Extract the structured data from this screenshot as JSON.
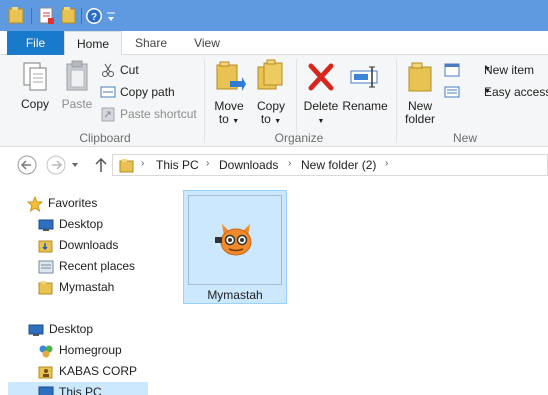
{
  "ribbon_tabs": {
    "file": "File",
    "home": "Home",
    "share": "Share",
    "view": "View"
  },
  "clipboard": {
    "copy": "Copy",
    "paste": "Paste",
    "cut": "Cut",
    "copy_path": "Copy path",
    "paste_shortcut": "Paste shortcut",
    "label": "Clipboard"
  },
  "organize": {
    "move_to": "Move",
    "move_to_2": "to",
    "copy_to": "Copy",
    "copy_to_2": "to",
    "delete": "Delete",
    "rename": "Rename",
    "label": "Organize"
  },
  "new": {
    "new_folder": "New",
    "new_folder_2": "folder",
    "new_item": "New item",
    "easy_access": "Easy access",
    "label": "New"
  },
  "breadcrumb": [
    "This PC",
    "Downloads",
    "New folder (2)"
  ],
  "nav": {
    "favorites": "Favorites",
    "desktop": "Desktop",
    "downloads": "Downloads",
    "recent_places": "Recent places",
    "mymastah": "Mymastah",
    "desktop_root": "Desktop",
    "homegroup": "Homegroup",
    "kabas": "KABAS CORP",
    "this_pc": "This PC"
  },
  "files": [
    {
      "name": "Mymastah"
    }
  ],
  "colors": {
    "titlebar": "#5f9ae0",
    "file_tab": "#1979ca",
    "selection": "#cce8ff",
    "selection_border": "#99d1ff"
  }
}
